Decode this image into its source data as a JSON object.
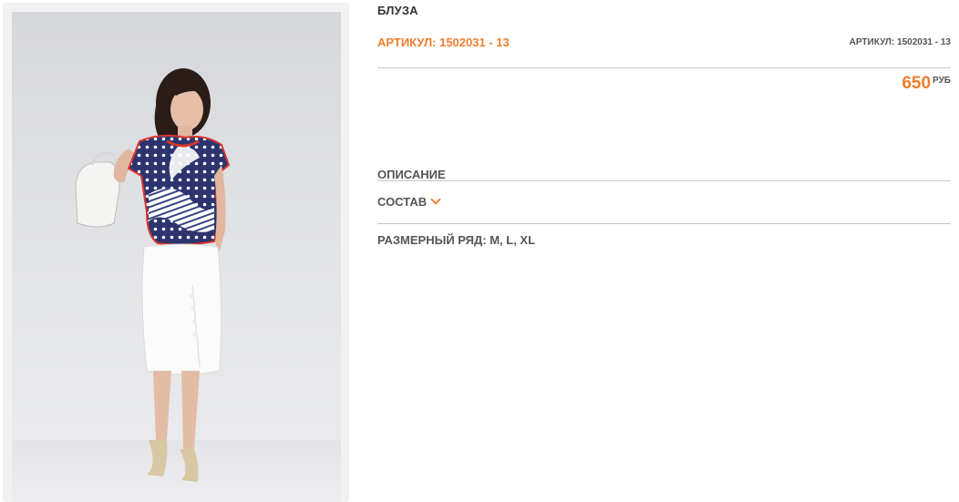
{
  "product": {
    "title": "БЛУЗА",
    "article_left": "АРТИКУЛ: 1502031 - 13",
    "article_right": "АРТИКУЛ: 1502031 - 13",
    "price": "650",
    "currency": "РУБ"
  },
  "sections": {
    "description_label": "ОПИСАНИЕ",
    "composition_label": "СОСТАВ",
    "sizes_label": "РАЗМЕРНЫЙ РЯД: M, L, XL"
  },
  "colors": {
    "accent": "#f07e2f",
    "text": "#555555",
    "title": "#333333",
    "divider": "#c6c6c6"
  },
  "icons": {
    "composition_toggle": "chevron-down-icon"
  }
}
